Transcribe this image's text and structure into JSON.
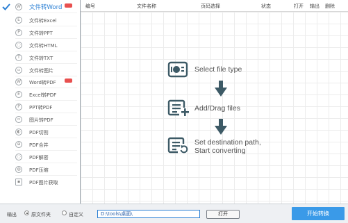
{
  "sidebar": {
    "items": [
      {
        "label": "文件转Word",
        "badge": true,
        "active": true
      },
      {
        "label": "文件转Excel",
        "badge": false
      },
      {
        "label": "文件转PPT",
        "badge": false
      },
      {
        "label": "文件转HTML",
        "badge": false
      },
      {
        "label": "文件转TXT",
        "badge": false
      },
      {
        "label": "文件转图片",
        "badge": false
      },
      {
        "label": "Word转PDF",
        "badge": true
      },
      {
        "label": "Excel转PDF",
        "badge": false
      },
      {
        "label": "PPT转PDF",
        "badge": false
      },
      {
        "label": "图片转PDF",
        "badge": false
      },
      {
        "label": "PDF切割",
        "badge": false
      },
      {
        "label": "PDF合并",
        "badge": false
      },
      {
        "label": "PDF解密",
        "badge": false
      },
      {
        "label": "PDF压缩",
        "badge": false
      },
      {
        "label": "PDF图片获取",
        "badge": false
      }
    ]
  },
  "table": {
    "columns": [
      "编号",
      "文件名称",
      "页码选择",
      "状态",
      "打开",
      "输出",
      "删除"
    ]
  },
  "steps": {
    "select": "Select file type",
    "add": "Add/Drag files",
    "dest_line1": "Set destination path,",
    "dest_line2": "Start converting"
  },
  "bottom": {
    "output_label": "输出",
    "radio_source": "原文件夹",
    "radio_custom": "自定义",
    "path_value": "D:\\tools\\桌面\\",
    "open_label": "打开",
    "start_label": "开始转换"
  },
  "colors": {
    "accent": "#2a7fd4",
    "step_icon": "#3d5a66",
    "badge": "#e8504f",
    "start_button": "#3a9ae8"
  }
}
